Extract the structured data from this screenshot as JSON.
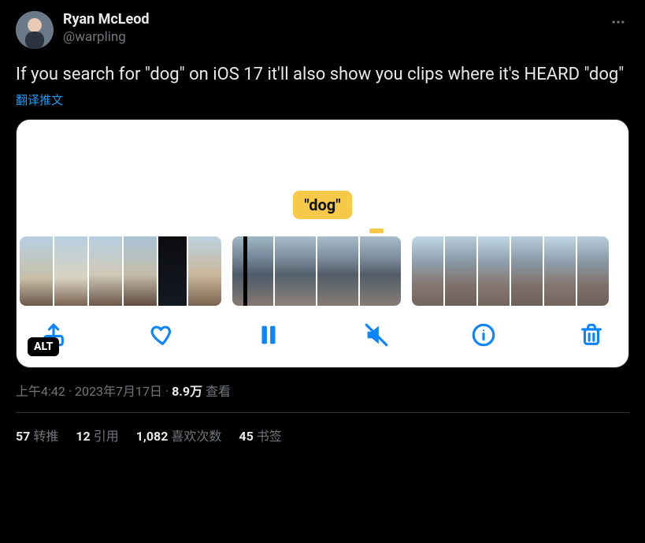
{
  "author": {
    "display_name": "Ryan McLeod",
    "handle": "@warpling"
  },
  "tweet_text": "If you search for \"dog\" on iOS 17 it'll also show you clips where it's HEARD \"dog\"",
  "translate_label": "翻译推文",
  "media": {
    "tag": "\"dog\"",
    "alt_badge": "ALT"
  },
  "meta": {
    "time": "上午4:42",
    "dot": " · ",
    "date": "2023年7月17日",
    "views_count": "8.9万",
    "views_label": " 查看"
  },
  "stats": {
    "retweets_count": "57",
    "retweets_label": "转推",
    "quotes_count": "12",
    "quotes_label": "引用",
    "likes_count": "1,082",
    "likes_label": "喜欢次数",
    "bookmarks_count": "45",
    "bookmarks_label": "书签"
  }
}
